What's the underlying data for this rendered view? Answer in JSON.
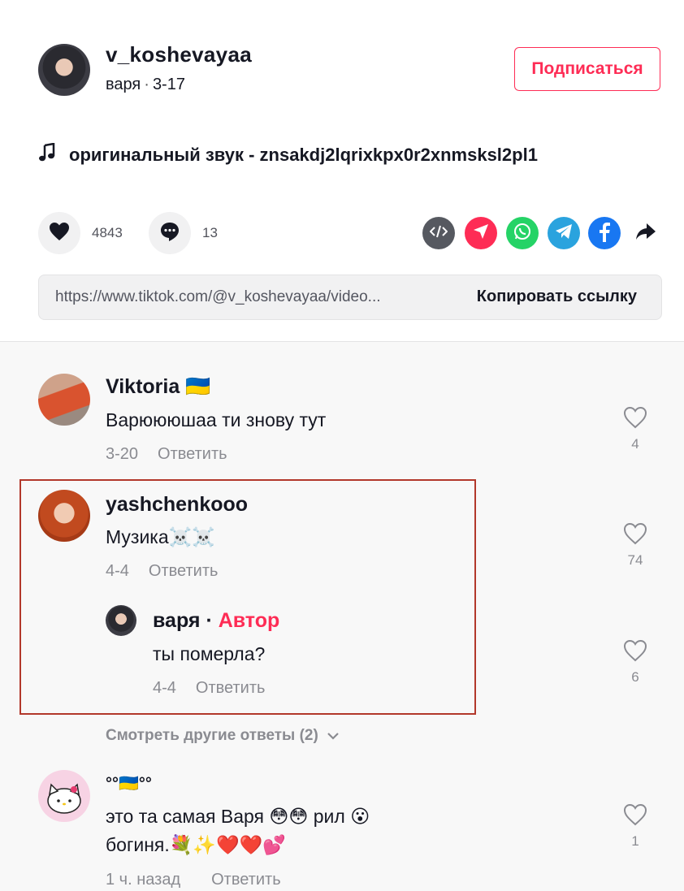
{
  "header": {
    "username": "v_koshevayaa",
    "nickname": "варя",
    "date": "3-17",
    "follow_label": "Подписаться"
  },
  "music": {
    "label": "оригинальный звук - znsakdj2lqrixkpx0r2xnmsksl2pl1"
  },
  "stats": {
    "likes": "4843",
    "comments": "13"
  },
  "share": {
    "icons": [
      "embed-icon",
      "send-icon",
      "whatsapp-icon",
      "telegram-icon",
      "facebook-icon",
      "share-arrow-icon"
    ]
  },
  "link": {
    "url": "https://www.tiktok.com/@v_koshevayaa/video...",
    "copy_label": "Копировать ссылку"
  },
  "comments": [
    {
      "user": "Viktoria 🇺🇦",
      "text": "Варюююшаа ти знову тут",
      "date": "3-20",
      "reply_label": "Ответить",
      "likes": "4"
    },
    {
      "user": "yashchenkooo",
      "text": "Музика☠️☠️",
      "date": "4-4",
      "reply_label": "Ответить",
      "likes": "74",
      "reply": {
        "user": "варя",
        "separator": "·",
        "author_tag": "Автор",
        "text": "ты померла?",
        "date": "4-4",
        "reply_label": "Ответить",
        "likes": "6"
      },
      "more_replies": "Смотреть другие ответы (2)"
    },
    {
      "user": "°°🇺🇦°°",
      "text_line1": "это та самая Варя 😳😳 рил 😮",
      "text_line2": "богиня.💐✨❤️❤️💕",
      "date": "1 ч. назад",
      "reply_label": "Ответить",
      "likes": "1"
    }
  ],
  "colors": {
    "accent": "#fe2c55",
    "highlight_border": "#b2382b",
    "muted_text": "#8a8b91"
  }
}
